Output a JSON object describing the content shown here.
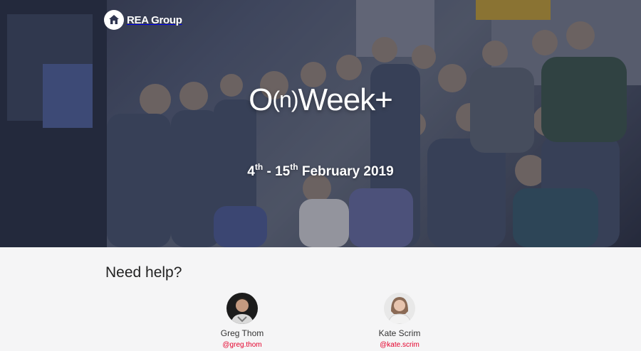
{
  "brand": {
    "name": "REA Group",
    "logo_icon": "house-icon"
  },
  "hero": {
    "title_prefix": "O",
    "title_paren": "(n)",
    "title_suffix": "Week+",
    "date_start_day": "4",
    "date_start_suffix": "th",
    "date_separator": " - 15",
    "date_end_suffix": "th",
    "date_rest": " February 2019"
  },
  "help": {
    "heading": "Need help?",
    "contacts": [
      {
        "name": "Greg Thom",
        "handle": "@greg.thom"
      },
      {
        "name": "Kate Scrim",
        "handle": "@kate.scrim"
      }
    ]
  },
  "colors": {
    "accent": "#e4002b",
    "overlay": "#1e2236",
    "footer_bg": "#f5f5f6"
  }
}
